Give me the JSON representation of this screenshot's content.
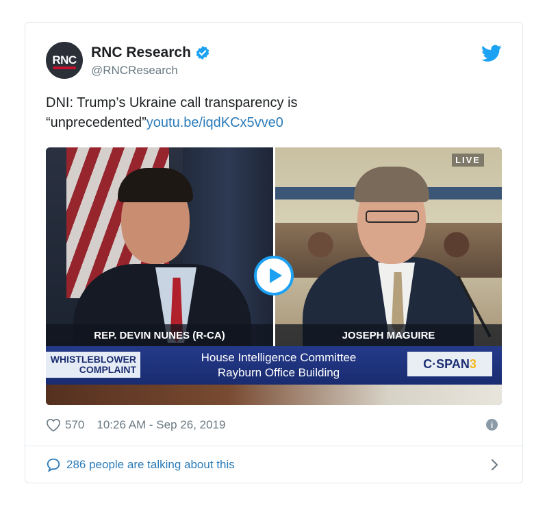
{
  "author": {
    "display_name": "RNC Research",
    "handle": "@RNCResearch",
    "avatar_text": "RNC",
    "verified": true
  },
  "tweet": {
    "text": "DNI: Trump’s Ukraine call transparency is “unprecedented”",
    "link_text": "youtu.be/iqdKCx5vve0"
  },
  "media": {
    "live_label": "LIVE",
    "left_caption": "REP. DEVIN NUNES (R-CA)",
    "right_caption": "JOSEPH MAGUIRE",
    "chyron_left_line1": "WHISTLEBLOWER",
    "chyron_left_line2": "COMPLAINT",
    "chyron_center_line1": "House Intelligence Committee",
    "chyron_center_line2": "Rayburn Office Building",
    "network_logo": "C·SPAN",
    "network_number": "3"
  },
  "meta": {
    "likes": "570",
    "timestamp": "10:26 AM - Sep 26, 2019"
  },
  "footer": {
    "talking_text": "286 people are talking about this"
  },
  "colors": {
    "twitter_blue": "#1da1f2",
    "link_blue": "#2b7bb9",
    "muted_gray": "#697882",
    "border": "#e1e8ed"
  },
  "icons": [
    "verified-badge-icon",
    "twitter-bird-icon",
    "play-icon",
    "heart-icon",
    "info-icon",
    "speech-bubble-icon",
    "chevron-right-icon"
  ]
}
